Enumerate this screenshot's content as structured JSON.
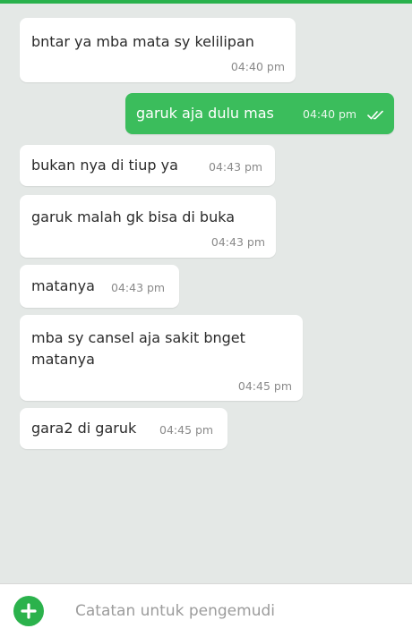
{
  "colors": {
    "accent": "#2bb24c",
    "outgoing_bubble": "#3bbd5c",
    "incoming_bubble": "#ffffff",
    "chat_background": "#e4e8e6"
  },
  "messages": [
    {
      "direction": "incoming",
      "text": "bntar ya mba mata sy kelilipan",
      "time": "04:40 pm"
    },
    {
      "direction": "outgoing",
      "text": "garuk aja dulu mas",
      "time": "04:40 pm",
      "status_icon": "double-check-icon"
    },
    {
      "direction": "incoming",
      "text": "bukan nya di tiup ya",
      "time": "04:43 pm"
    },
    {
      "direction": "incoming",
      "text": "garuk malah gk bisa di buka",
      "time": "04:43 pm"
    },
    {
      "direction": "incoming",
      "text": "matanya",
      "time": "04:43 pm"
    },
    {
      "direction": "incoming",
      "text_lines": [
        "mba sy cansel aja sakit bnget",
        "matanya"
      ],
      "time": "04:45 pm"
    },
    {
      "direction": "incoming",
      "text": "gara2 di garuk",
      "time": "04:45 pm"
    }
  ],
  "composer": {
    "placeholder": "Catatan untuk pengemudi",
    "value": "",
    "add_icon": "plus-icon"
  }
}
